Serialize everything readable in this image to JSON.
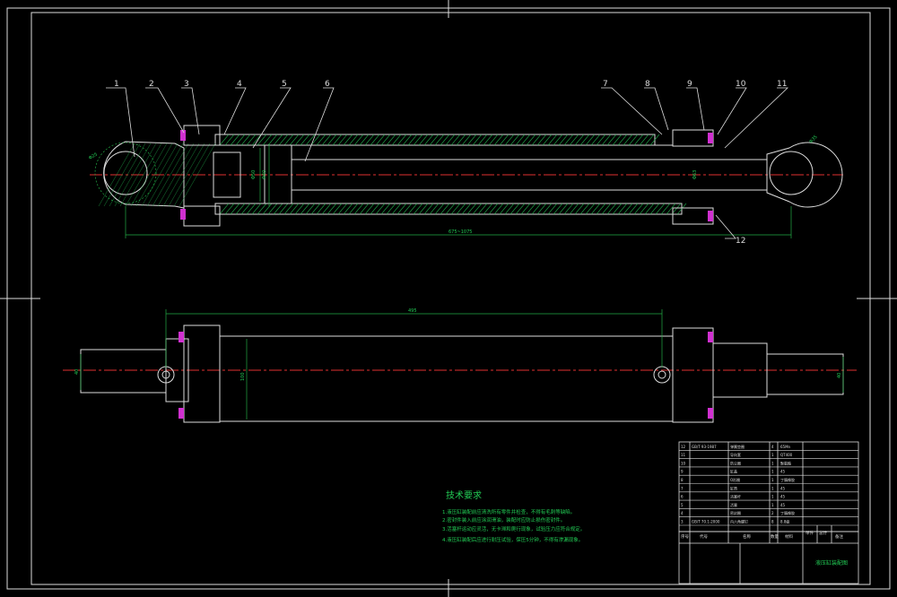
{
  "drawing": {
    "part_numbers": [
      "1",
      "2",
      "3",
      "4",
      "5",
      "6",
      "7",
      "8",
      "9",
      "10",
      "11",
      "12"
    ],
    "dimensions": {
      "overall_length": "675~1075",
      "stroke": "495",
      "bore": "Φ50",
      "rod_bore": "Φ40",
      "outer_dia": "Φ63",
      "small_1": "Φ25",
      "small_2": "Φ35",
      "end_left": "Φ32",
      "end_right": "Φ32",
      "body_height": "100",
      "side_left": "40",
      "side_right": "40"
    },
    "tech_req": {
      "title": "技术要求",
      "items": [
        "1.液压缸装配前应清洗所有零件并检查，不得有毛刺等缺陷。",
        "2.密封件装入前应涂润滑油，装配时应防止损伤密封件。",
        "3.活塞杆运动应灵活，无卡滞和爬行现象，试验压力应符合规定。",
        "4.液压缸装配后应进行耐压试验，保压5分钟，不得有渗漏现象。"
      ]
    }
  },
  "title_block": {
    "bom_rows": [
      [
        "12",
        "GB/T 93-1987",
        "弹簧垫圈",
        "4",
        "65Mn"
      ],
      [
        "11",
        "",
        "导向套",
        "1",
        "QT400"
      ],
      [
        "10",
        "",
        "防尘圈",
        "1",
        "聚氨酯"
      ],
      [
        "9",
        "",
        "缸盖",
        "1",
        "45"
      ],
      [
        "8",
        "",
        "O形圈",
        "1",
        "丁腈橡胶"
      ],
      [
        "7",
        "",
        "缸筒",
        "1",
        "45"
      ],
      [
        "6",
        "",
        "活塞杆",
        "1",
        "45"
      ],
      [
        "5",
        "",
        "活塞",
        "1",
        "45"
      ],
      [
        "4",
        "",
        "密封圈",
        "2",
        "丁腈橡胶"
      ],
      [
        "3",
        "GB/T 70.1-2000",
        "内六角螺钉",
        "8",
        "8.8级"
      ]
    ],
    "header": [
      "序号",
      "代号",
      "名称",
      "数量",
      "材料",
      "单件",
      "总计",
      "备注"
    ],
    "drawing_title": "液压缸装配图"
  }
}
